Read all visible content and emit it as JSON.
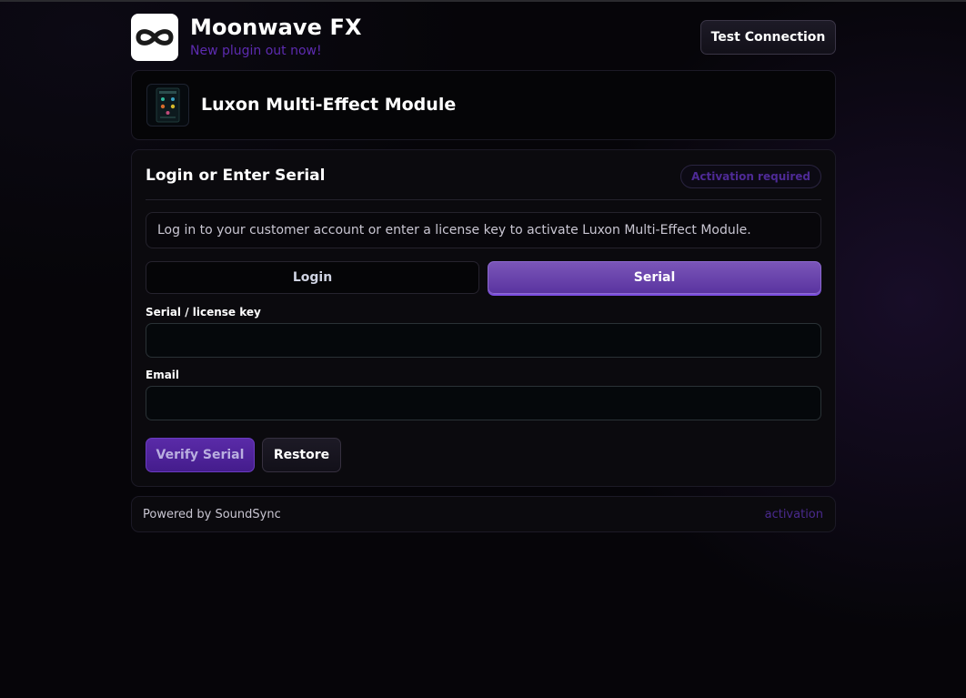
{
  "header": {
    "brand_name": "Moonwave FX",
    "brand_subtitle": "New plugin out now!",
    "test_connection_label": "Test Connection",
    "logo_icon": "infinity-icon"
  },
  "product": {
    "name": "Luxon Multi-Effect Module",
    "thumbnail_icon": "plugin-thumbnail-icon"
  },
  "activation": {
    "title": "Login or Enter Serial",
    "badge": "Activation required",
    "info": "Log in to your customer account or enter a license key to activate Luxon Multi-Effect Module.",
    "tabs": [
      {
        "label": "Login",
        "active": false
      },
      {
        "label": "Serial",
        "active": true
      }
    ],
    "fields": {
      "serial_label": "Serial / license key",
      "serial_value": "",
      "email_label": "Email",
      "email_value": ""
    },
    "verify_label": "Verify Serial",
    "restore_label": "Restore"
  },
  "footer": {
    "powered_by": "Powered by SoundSync",
    "link": "activation"
  },
  "colors": {
    "accent": "#6a3cc0",
    "accent_text": "#5d2bb0",
    "background": "#060509"
  }
}
